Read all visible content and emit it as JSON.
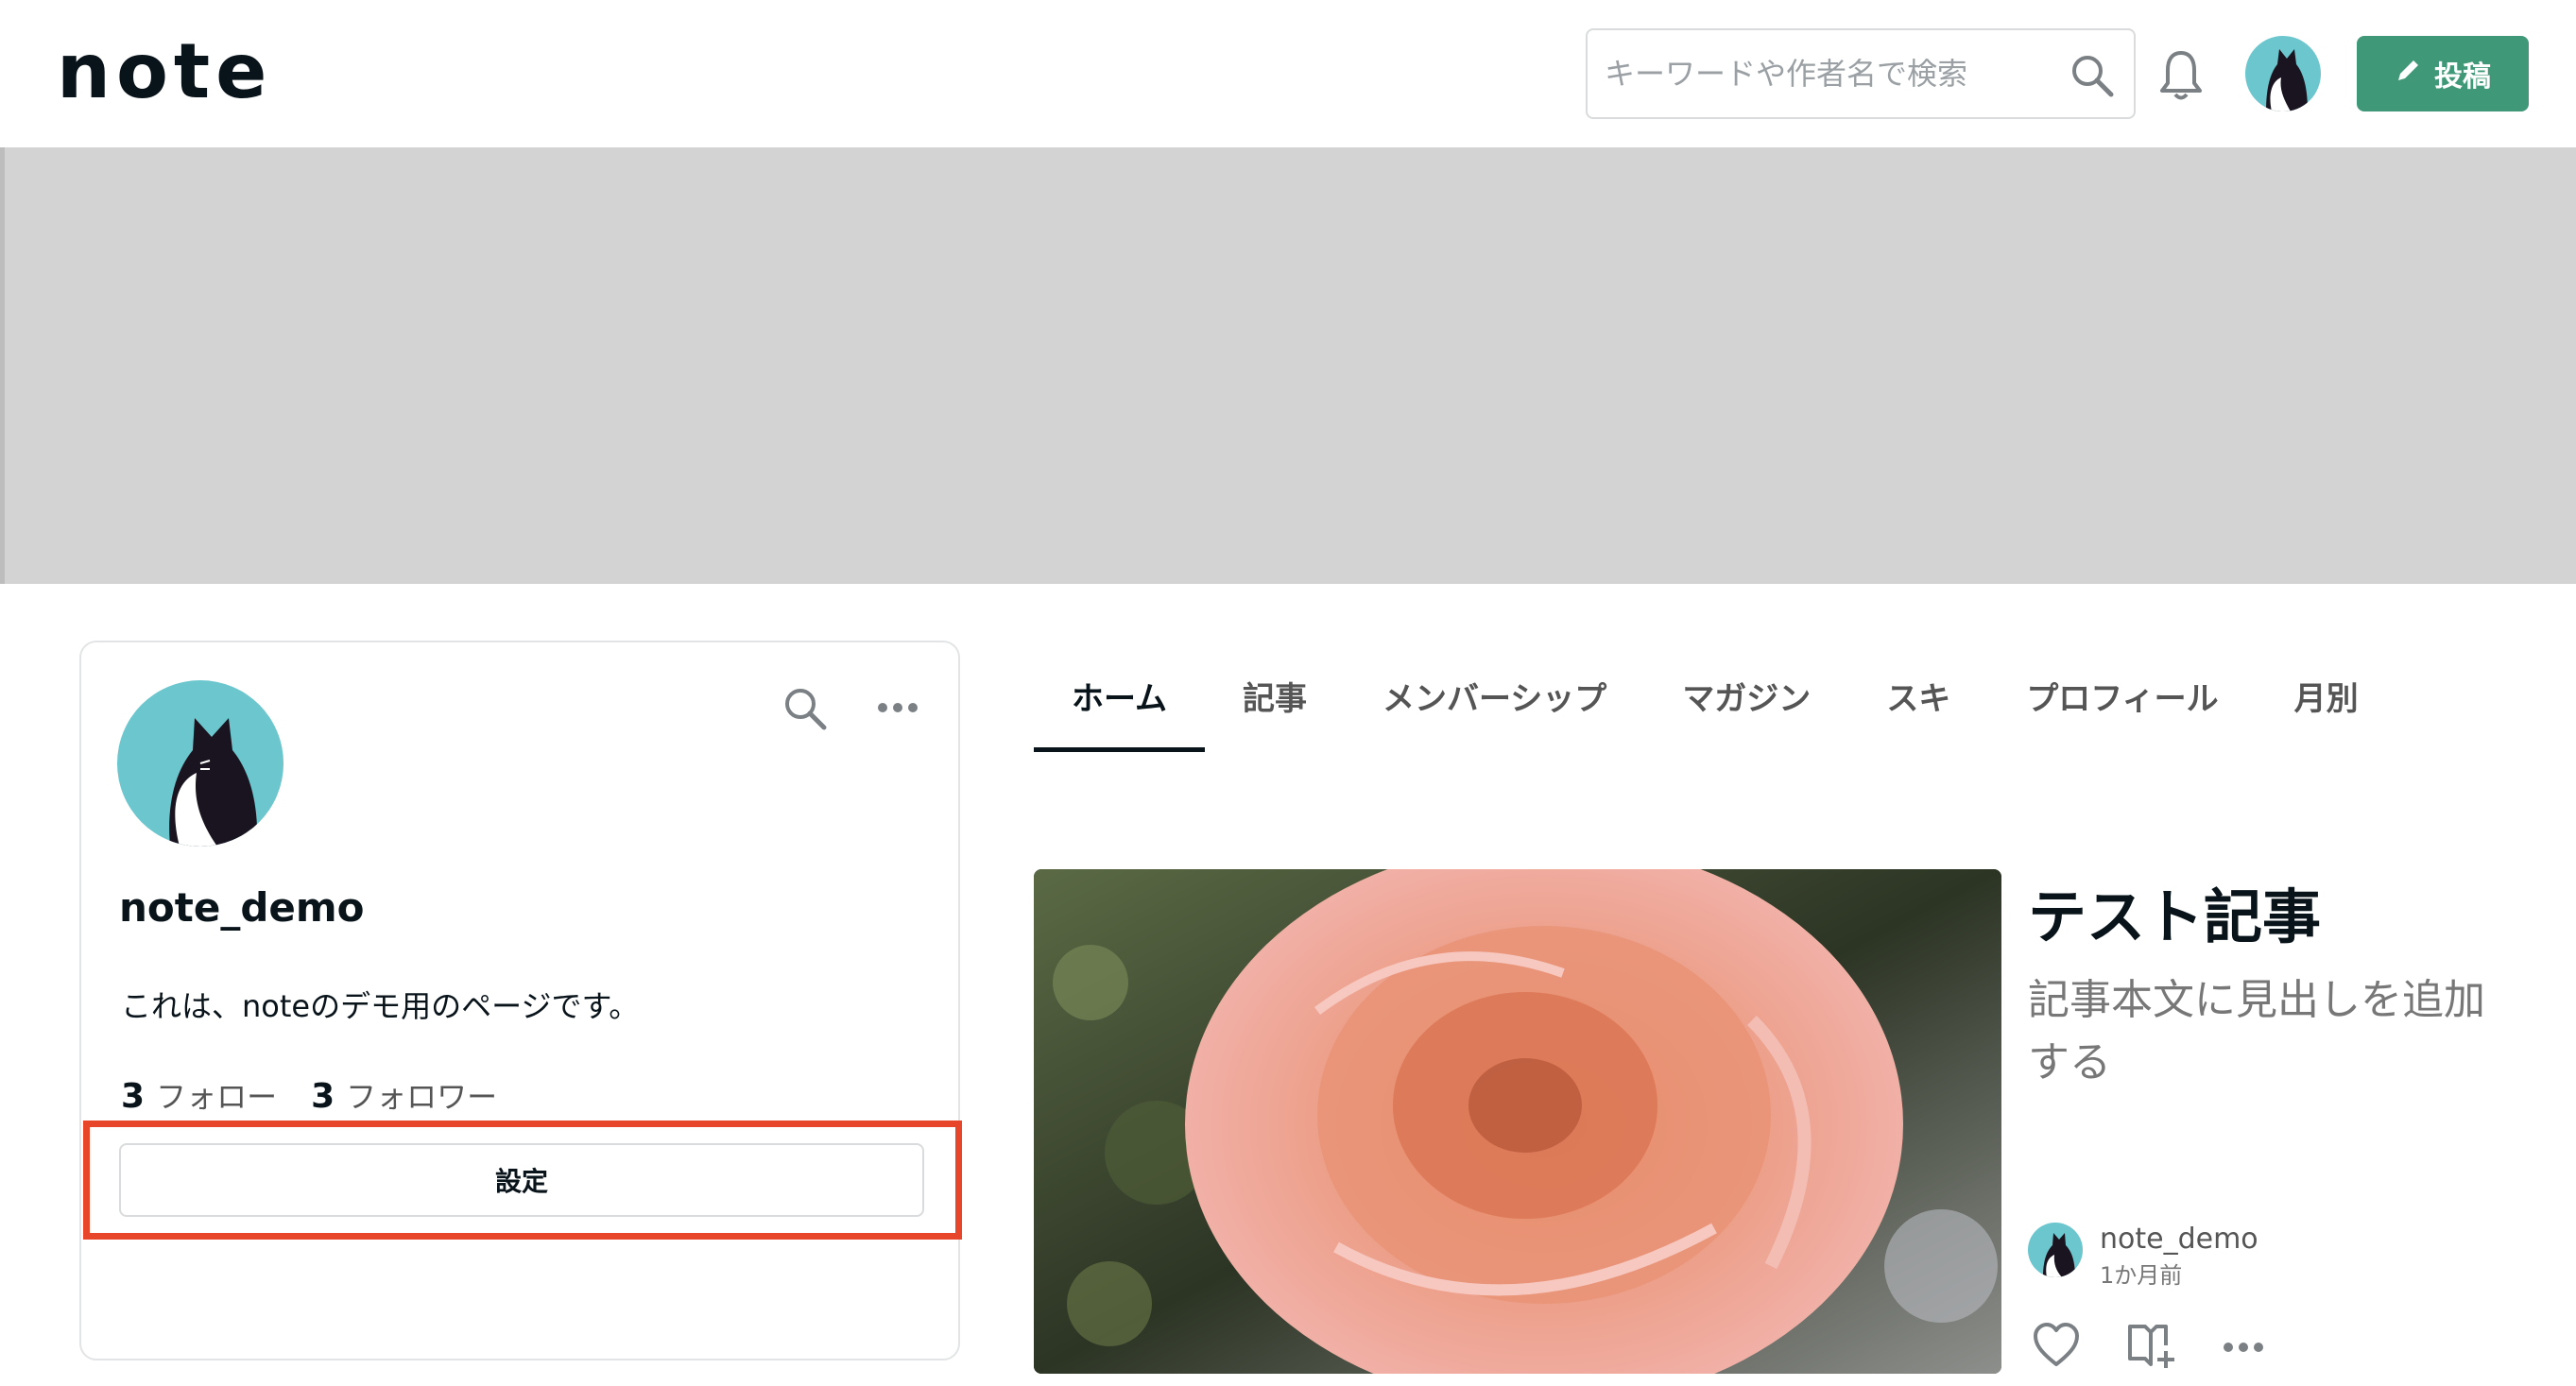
{
  "header": {
    "logo": "note",
    "search_placeholder": "キーワードや作者名で検索",
    "post_label": "投稿"
  },
  "profile": {
    "username": "note_demo",
    "bio": "これは、noteのデモ用のページです。",
    "follow_count": "3",
    "follow_label": "フォロー",
    "follower_count": "3",
    "follower_label": "フォロワー",
    "settings_label": "設定"
  },
  "tabs": [
    {
      "label": "ホーム"
    },
    {
      "label": "記事"
    },
    {
      "label": "メンバーシップ"
    },
    {
      "label": "マガジン"
    },
    {
      "label": "スキ"
    },
    {
      "label": "プロフィール"
    },
    {
      "label": "月別"
    }
  ],
  "article": {
    "title": "テスト記事",
    "subtitle": "記事本文に見出しを追加する",
    "author": "note_demo",
    "time": "1か月前"
  },
  "colors": {
    "accent": "#3f9877",
    "highlight": "#e8462b",
    "avatar_bg": "#6cc6ce",
    "banner": "#d3d3d3"
  }
}
